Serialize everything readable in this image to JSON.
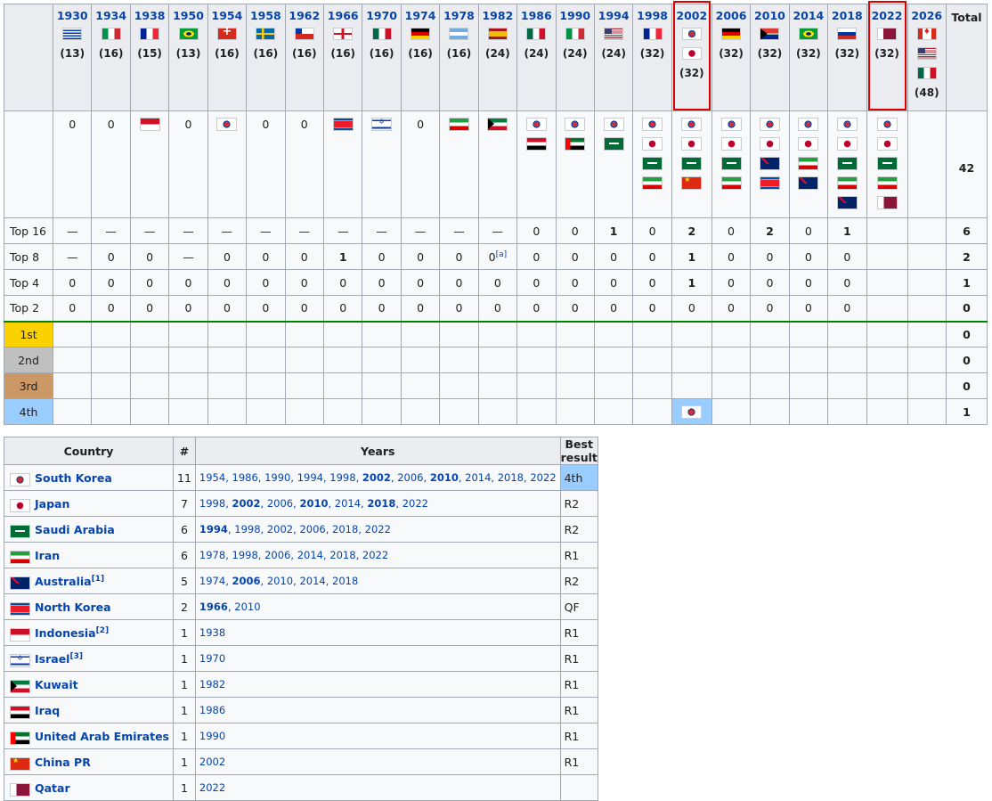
{
  "years": [
    {
      "year": "1930",
      "flag": "uy",
      "teams": "(13)"
    },
    {
      "year": "1934",
      "flag": "it",
      "teams": "(16)"
    },
    {
      "year": "1938",
      "flag": "fr",
      "teams": "(15)"
    },
    {
      "year": "1950",
      "flag": "br",
      "teams": "(13)"
    },
    {
      "year": "1954",
      "flag": "ch",
      "teams": "(16)"
    },
    {
      "year": "1958",
      "flag": "se",
      "teams": "(16)"
    },
    {
      "year": "1962",
      "flag": "cl",
      "teams": "(16)"
    },
    {
      "year": "1966",
      "flag": "en",
      "teams": "(16)"
    },
    {
      "year": "1970",
      "flag": "mx",
      "teams": "(16)"
    },
    {
      "year": "1974",
      "flag": "de",
      "teams": "(16)"
    },
    {
      "year": "1978",
      "flag": "ar",
      "teams": "(16)"
    },
    {
      "year": "1982",
      "flag": "es",
      "teams": "(24)"
    },
    {
      "year": "1986",
      "flag": "mx",
      "teams": "(24)"
    },
    {
      "year": "1990",
      "flag": "it",
      "teams": "(24)"
    },
    {
      "year": "1994",
      "flag": "us",
      "teams": "(24)"
    },
    {
      "year": "1998",
      "flag": "fr",
      "teams": "(32)"
    },
    {
      "year": "2002",
      "flag": "kr jp",
      "teams": "(32)",
      "highlight": true
    },
    {
      "year": "2006",
      "flag": "de",
      "teams": "(32)"
    },
    {
      "year": "2010",
      "flag": "za",
      "teams": "(32)"
    },
    {
      "year": "2014",
      "flag": "br",
      "teams": "(32)"
    },
    {
      "year": "2018",
      "flag": "ru",
      "teams": "(32)"
    },
    {
      "year": "2022",
      "flag": "qa",
      "teams": "(32)",
      "highlight": true
    },
    {
      "year": "2026",
      "flag": "ca us mx",
      "teams": "(48)"
    }
  ],
  "total_label": "Total",
  "participants": [
    {
      "text": "0"
    },
    {
      "text": "0"
    },
    {
      "flags": "id"
    },
    {
      "text": "0"
    },
    {
      "flags": "kr"
    },
    {
      "text": "0"
    },
    {
      "text": "0"
    },
    {
      "flags": "kp"
    },
    {
      "flags": "il"
    },
    {
      "text": "0"
    },
    {
      "flags": "ir"
    },
    {
      "flags": "kw"
    },
    {
      "flags": "kr iq"
    },
    {
      "flags": "kr ae"
    },
    {
      "flags": "kr sa"
    },
    {
      "flags": "kr jp sa ir"
    },
    {
      "flags": "kr jp sa cn2"
    },
    {
      "flags": "kr jp sa ir"
    },
    {
      "flags": "kr jp au kp"
    },
    {
      "flags": "kr jp ir au"
    },
    {
      "flags": "kr jp sa ir au"
    },
    {
      "flags": "kr jp sa ir qa"
    },
    {
      "text": ""
    }
  ],
  "participants_total": "42",
  "rows": [
    {
      "label": "Top 16",
      "cells": [
        "—",
        "—",
        "—",
        "—",
        "—",
        "—",
        "—",
        "—",
        "—",
        "—",
        "—",
        "—",
        "0",
        "0",
        "1",
        "0",
        "2",
        "0",
        "2",
        "0",
        "1",
        "",
        ""
      ],
      "total": "6"
    },
    {
      "label": "Top 8",
      "cells": [
        "—",
        "0",
        "0",
        "—",
        "0",
        "0",
        "0",
        "1",
        "0",
        "0",
        "0",
        "0",
        "0",
        "0",
        "0",
        "0",
        "1",
        "0",
        "0",
        "0",
        "0",
        "",
        ""
      ],
      "total": "2",
      "note_index": 11,
      "note": "[a]"
    },
    {
      "label": "Top 4",
      "cells": [
        "0",
        "0",
        "0",
        "0",
        "0",
        "0",
        "0",
        "0",
        "0",
        "0",
        "0",
        "0",
        "0",
        "0",
        "0",
        "0",
        "1",
        "0",
        "0",
        "0",
        "0",
        "",
        ""
      ],
      "total": "1"
    },
    {
      "label": "Top 2",
      "cells": [
        "0",
        "0",
        "0",
        "0",
        "0",
        "0",
        "0",
        "0",
        "0",
        "0",
        "0",
        "0",
        "0",
        "0",
        "0",
        "0",
        "0",
        "0",
        "0",
        "0",
        "0",
        "",
        ""
      ],
      "total": "0"
    }
  ],
  "medals": [
    {
      "label": "1st",
      "cls": "m1",
      "total": "0"
    },
    {
      "label": "2nd",
      "cls": "m2",
      "total": "0"
    },
    {
      "label": "3rd",
      "cls": "m3",
      "total": "0"
    },
    {
      "label": "4th",
      "cls": "m4",
      "total": "1",
      "flag_col": 16,
      "flag": "kr"
    }
  ],
  "bold_cells": {
    "Top 16": [
      14,
      16,
      18,
      20
    ],
    "Top 8": [
      7,
      16
    ],
    "Top 4": [
      16
    ]
  },
  "country_table": {
    "headers": [
      "Country",
      "#",
      "Years",
      "Best result"
    ],
    "rows": [
      {
        "flag": "kr",
        "name": "South Korea",
        "count": "11",
        "years": [
          {
            "y": "1954"
          },
          {
            "y": "1986"
          },
          {
            "y": "1990"
          },
          {
            "y": "1994"
          },
          {
            "y": "1998"
          },
          {
            "y": "2002",
            "b": true
          },
          {
            "y": "2006"
          },
          {
            "y": "2010",
            "b": true
          },
          {
            "y": "2014"
          },
          {
            "y": "2018"
          },
          {
            "y": "2022"
          }
        ],
        "best": "4th",
        "best_hl": true
      },
      {
        "flag": "jp",
        "name": "Japan",
        "count": "7",
        "years": [
          {
            "y": "1998"
          },
          {
            "y": "2002",
            "b": true
          },
          {
            "y": "2006"
          },
          {
            "y": "2010",
            "b": true
          },
          {
            "y": "2014"
          },
          {
            "y": "2018",
            "b": true
          },
          {
            "y": "2022"
          }
        ],
        "best": "R2"
      },
      {
        "flag": "sa",
        "name": "Saudi Arabia",
        "count": "6",
        "years": [
          {
            "y": "1994",
            "b": true
          },
          {
            "y": "1998"
          },
          {
            "y": "2002"
          },
          {
            "y": "2006"
          },
          {
            "y": "2018"
          },
          {
            "y": "2022"
          }
        ],
        "best": "R2"
      },
      {
        "flag": "ir",
        "name": "Iran",
        "count": "6",
        "years": [
          {
            "y": "1978"
          },
          {
            "y": "1998"
          },
          {
            "y": "2006"
          },
          {
            "y": "2014"
          },
          {
            "y": "2018"
          },
          {
            "y": "2022"
          }
        ],
        "best": "R1"
      },
      {
        "flag": "au",
        "name": "Australia",
        "sup": "[1]",
        "count": "5",
        "years": [
          {
            "y": "1974"
          },
          {
            "y": "2006",
            "b": true
          },
          {
            "y": "2010"
          },
          {
            "y": "2014"
          },
          {
            "y": "2018"
          }
        ],
        "best": "R2"
      },
      {
        "flag": "kp",
        "name": "North Korea",
        "count": "2",
        "years": [
          {
            "y": "1966",
            "b": true
          },
          {
            "y": "2010"
          }
        ],
        "best": "QF"
      },
      {
        "flag": "id",
        "name": "Indonesia",
        "sup": "[2]",
        "count": "1",
        "years": [
          {
            "y": "1938"
          }
        ],
        "best": "R1"
      },
      {
        "flag": "il",
        "name": "Israel",
        "sup": "[3]",
        "count": "1",
        "years": [
          {
            "y": "1970"
          }
        ],
        "best": "R1"
      },
      {
        "flag": "kw",
        "name": "Kuwait",
        "count": "1",
        "years": [
          {
            "y": "1982"
          }
        ],
        "best": "R1"
      },
      {
        "flag": "iq",
        "name": "Iraq",
        "count": "1",
        "years": [
          {
            "y": "1986"
          }
        ],
        "best": "R1"
      },
      {
        "flag": "ae",
        "name": "United Arab Emirates",
        "count": "1",
        "years": [
          {
            "y": "1990"
          }
        ],
        "best": "R1"
      },
      {
        "flag": "cn2",
        "name": "China PR",
        "count": "1",
        "years": [
          {
            "y": "2002"
          }
        ],
        "best": "R1"
      },
      {
        "flag": "qa",
        "name": "Qatar",
        "count": "1",
        "years": [
          {
            "y": "2022"
          }
        ],
        "best": ""
      }
    ]
  }
}
